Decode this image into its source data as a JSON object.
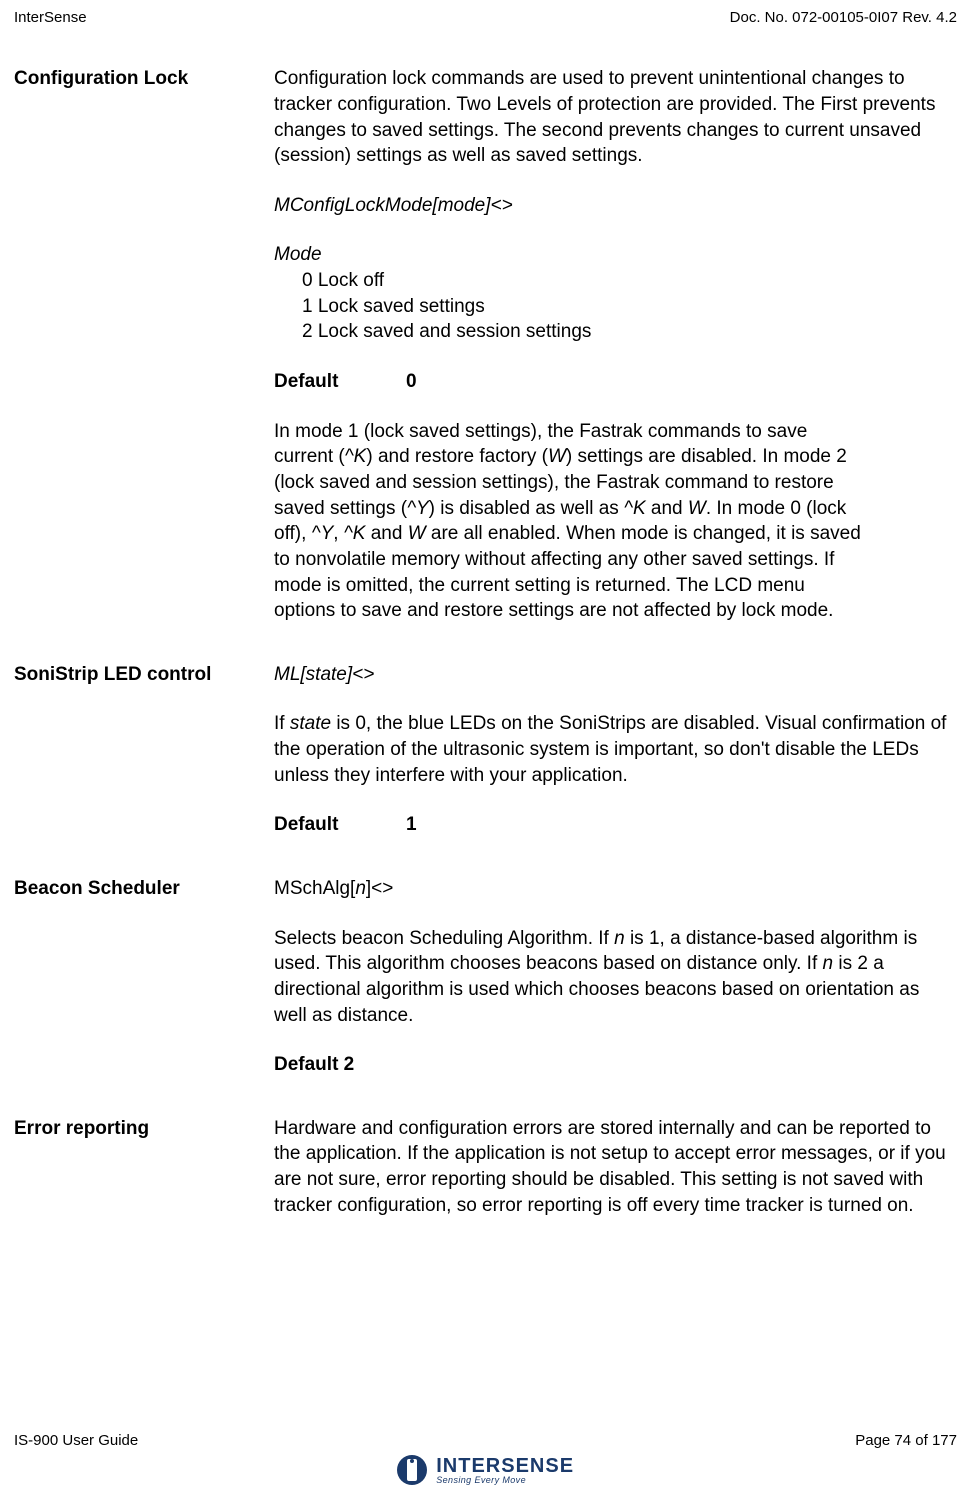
{
  "header": {
    "left": "InterSense",
    "right": "Doc. No. 072-00105-0I07 Rev. 4.2"
  },
  "sections": {
    "config_lock": {
      "label": "Configuration Lock",
      "p1": "Configuration lock commands are used to prevent unintentional changes to tracker configuration.  Two Levels of protection are provided.  The First prevents changes to saved settings.  The second prevents changes to current unsaved (session) settings as well as saved settings.",
      "cmd": "MConfigLockMode[mode]<>",
      "mode_label": "Mode",
      "mode_0": "0 Lock off",
      "mode_1": "1 Lock saved settings",
      "mode_2": "2 Lock saved and session settings",
      "default_label": "Default",
      "default_value": "0",
      "p2_a": "In mode 1 (lock saved settings), the Fastrak commands to save current (",
      "p2_b": "^K",
      "p2_c": ") and restore factory (",
      "p2_d": "W",
      "p2_e": ") settings are disabled.  In mode 2 (lock saved and session settings), the Fastrak command to restore saved settings (",
      "p2_f": "^Y",
      "p2_g": ") is disabled as well as ",
      "p2_h": "^K",
      "p2_i": " and ",
      "p2_j": "W",
      "p2_k": ". In mode 0 (lock off), ",
      "p2_l": "^Y",
      "p2_m": ", ",
      "p2_n": "^K",
      "p2_o": " and ",
      "p2_p": "W",
      "p2_q": " are all enabled. When mode is changed, it is saved to nonvolatile memory without affecting any other saved settings.  If mode is omitted, the current setting is returned. The LCD menu options to save and restore settings are not affected by lock mode."
    },
    "sonistrip": {
      "label": "SoniStrip LED control",
      "cmd": "ML[state]<>",
      "p1_a": "If ",
      "p1_b": "state",
      "p1_c": " is 0, the blue LEDs on the SoniStrips are disabled.  Visual confirmation of the operation of the ultrasonic system is important, so don't disable the LEDs unless they interfere with your application.",
      "default_label": "Default",
      "default_value": "1"
    },
    "beacon": {
      "label": "Beacon Scheduler",
      "cmd_a": "MSchAlg[",
      "cmd_b": "n",
      "cmd_c": "]<>",
      "p1_a": "Selects beacon Scheduling Algorithm.  If ",
      "p1_b": "n",
      "p1_c": " is 1, a distance-based algorithm is used.  This algorithm chooses beacons based on distance only.  If ",
      "p1_d": "n",
      "p1_e": " is 2 a directional algorithm is used which chooses beacons based on orientation as well as distance.",
      "default": "Default 2"
    },
    "error": {
      "label": "Error reporting",
      "p1": "Hardware and configuration errors are stored internally and can be reported to the application.  If the application is not setup to accept error messages, or if you are not sure, error reporting should be disabled.  This setting is not saved with tracker configuration, so error reporting is off every time tracker is turned on."
    }
  },
  "footer": {
    "left": "IS-900 User Guide",
    "right": "Page 74 of 177",
    "logo_main": "INTERSENSE",
    "logo_sub": "Sensing Every Move"
  }
}
